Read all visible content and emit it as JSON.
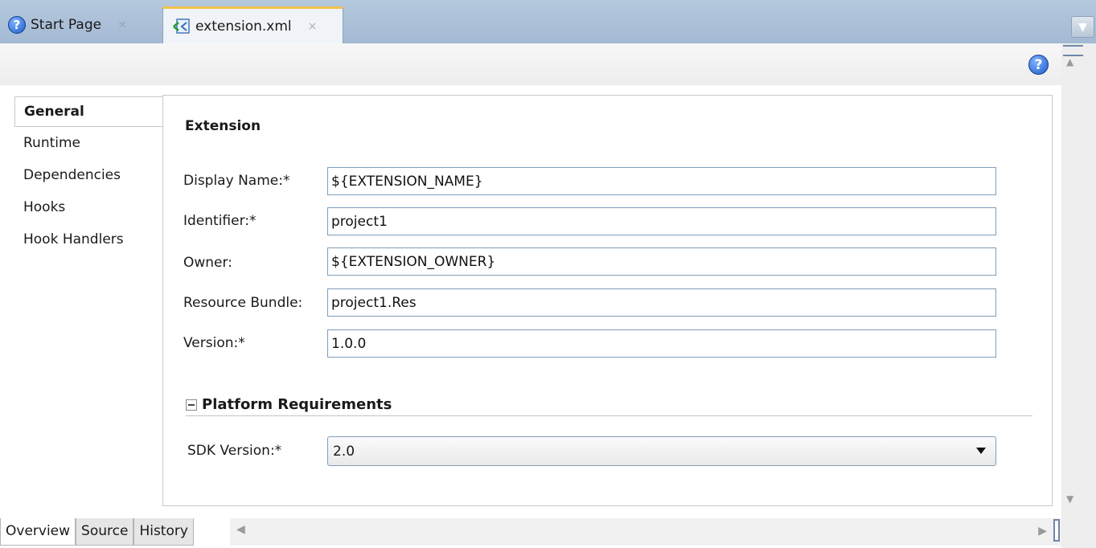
{
  "tabs": [
    {
      "label": "Start Page",
      "close": "×",
      "icon": "help-icon"
    },
    {
      "label": "extension.xml",
      "close": "×",
      "icon": "xml-file-icon"
    }
  ],
  "toolbar": {
    "help_glyph": "?"
  },
  "nav": {
    "items": [
      "General",
      "Runtime",
      "Dependencies",
      "Hooks",
      "Hook Handlers"
    ],
    "active": "General"
  },
  "extension": {
    "title": "Extension",
    "fields": [
      {
        "label": "Display Name:*",
        "value": "${EXTENSION_NAME}"
      },
      {
        "label": "Identifier:*",
        "value": "project1"
      },
      {
        "label": "Owner:",
        "value": "${EXTENSION_OWNER}"
      },
      {
        "label": "Resource Bundle:",
        "value": "project1.Res"
      },
      {
        "label": "Version:*",
        "value": "1.0.0"
      }
    ]
  },
  "platform": {
    "title": "Platform Requirements",
    "sdk_label": "SDK Version:*",
    "sdk_value": "2.0"
  },
  "bottom_tabs": [
    "Overview",
    "Source",
    "History"
  ],
  "colors": {
    "tab_strip": "#a4bad3",
    "active_tab_accent": "#f2c24a",
    "field_border": "#7f9db9"
  }
}
